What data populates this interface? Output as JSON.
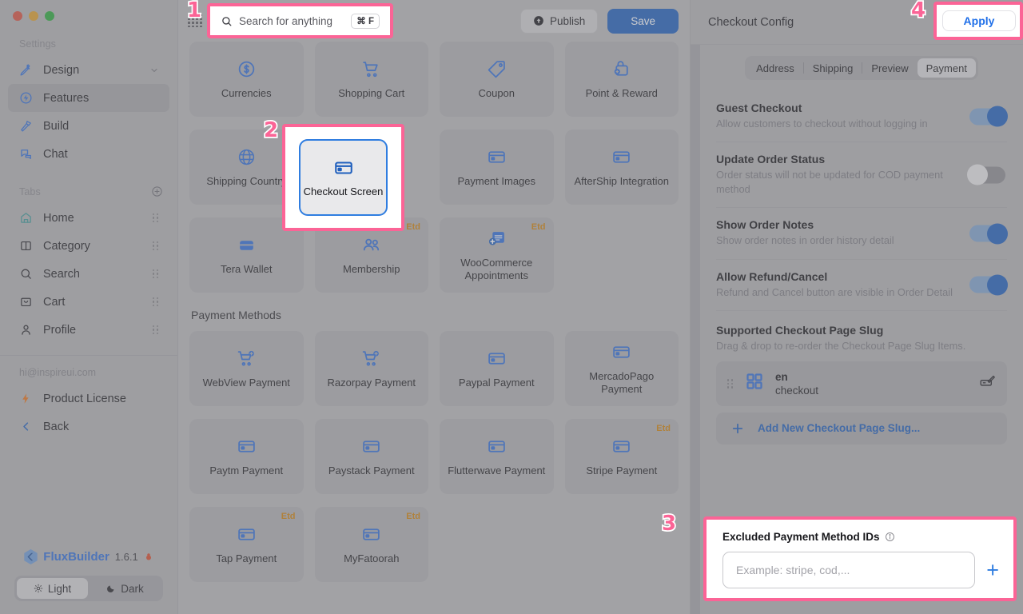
{
  "sidebar": {
    "settings_label": "Settings",
    "settings_items": [
      {
        "label": "Design",
        "icon": "design-icon",
        "chevron": true
      },
      {
        "label": "Features",
        "icon": "features-icon",
        "active": true
      },
      {
        "label": "Build",
        "icon": "build-icon"
      },
      {
        "label": "Chat",
        "icon": "chat-icon"
      }
    ],
    "tabs_label": "Tabs",
    "tabs_add_icon": "add-circle-icon",
    "tabs": [
      {
        "label": "Home",
        "icon": "home-icon"
      },
      {
        "label": "Category",
        "icon": "category-icon"
      },
      {
        "label": "Search",
        "icon": "search-icon"
      },
      {
        "label": "Cart",
        "icon": "cart-icon"
      },
      {
        "label": "Profile",
        "icon": "profile-icon"
      }
    ],
    "email": "hi@inspireui.com",
    "product_license": "Product License",
    "back": "Back",
    "brand_name": "FluxBuilder",
    "brand_version": "1.6.1",
    "theme": {
      "light": "Light",
      "dark": "Dark",
      "selected": "Light"
    }
  },
  "topbar": {
    "grid_icon": "app-grid-icon",
    "search_placeholder": "Search for anything",
    "search_shortcut": "⌘ F",
    "publish_label": "Publish",
    "save_label": "Save"
  },
  "features": {
    "tiles_row1": [
      {
        "name": "Currencies",
        "icon": "currency-dollar-icon"
      },
      {
        "name": "Shopping Cart",
        "icon": "shopping-cart-icon"
      },
      {
        "name": "Coupon",
        "icon": "coupon-tag-icon"
      },
      {
        "name": "Point & Reward",
        "icon": "point-reward-icon"
      }
    ],
    "tiles_row2": [
      {
        "name": "Shipping Country",
        "icon": "globe-icon"
      },
      {
        "name": "Checkout Screen",
        "icon": "credit-card-icon",
        "selected": true
      },
      {
        "name": "Payment Images",
        "icon": "credit-card-icon"
      },
      {
        "name": "AfterShip Integration",
        "icon": "credit-card-icon"
      }
    ],
    "tiles_row3": [
      {
        "name": "Tera Wallet",
        "icon": "wallet-icon"
      },
      {
        "name": "Membership",
        "icon": "members-icon",
        "badge": "Etd"
      },
      {
        "name": "WooCommerce Appointments",
        "icon": "appointments-icon",
        "badge": "Etd"
      }
    ],
    "payment_group_title": "Payment Methods",
    "payment_row1": [
      {
        "name": "WebView Payment",
        "icon": "cart-plus-icon"
      },
      {
        "name": "Razorpay Payment",
        "icon": "cart-plus-icon"
      },
      {
        "name": "Paypal Payment",
        "icon": "credit-card-icon"
      },
      {
        "name": "MercadoPago Payment",
        "icon": "credit-card-icon"
      }
    ],
    "payment_row2": [
      {
        "name": "Paytm Payment",
        "icon": "credit-card-icon"
      },
      {
        "name": "Paystack Payment",
        "icon": "credit-card-icon"
      },
      {
        "name": "Flutterwave Payment",
        "icon": "credit-card-icon"
      },
      {
        "name": "Stripe Payment",
        "icon": "credit-card-icon",
        "badge": "Etd"
      }
    ],
    "payment_row3": [
      {
        "name": "Tap Payment",
        "icon": "credit-card-icon",
        "badge": "Etd"
      },
      {
        "name": "MyFatoorah",
        "icon": "credit-card-icon",
        "badge": "Etd"
      }
    ]
  },
  "panel": {
    "title": "Checkout Config",
    "apply_label": "Apply",
    "tabs": [
      {
        "label": "Address"
      },
      {
        "label": "Shipping"
      },
      {
        "label": "Preview"
      },
      {
        "label": "Payment",
        "selected": true
      }
    ],
    "settings": [
      {
        "title": "Guest Checkout",
        "desc": "Allow customers to checkout without logging in",
        "toggle": "on"
      },
      {
        "title": "Update Order Status",
        "desc": "Order status will not be updated for COD payment method",
        "toggle": "off"
      },
      {
        "title": "Show Order Notes",
        "desc": "Show order notes in order history detail",
        "toggle": "on"
      },
      {
        "title": "Allow Refund/Cancel",
        "desc": "Refund and Cancel button are visible in Order Detail",
        "toggle": "on"
      }
    ],
    "slug": {
      "title": "Supported Checkout Page Slug",
      "desc": "Drag & drop to re-order the Checkout Page Slug Items.",
      "item": {
        "lang": "en",
        "path": "checkout",
        "edit_icon": "edit-pen-icon",
        "drag_icon": "drag-handle-icon",
        "grid_icon": "grid-squares-icon"
      },
      "add_label": "Add New Checkout Page Slug..."
    },
    "excluded": {
      "label": "Excluded Payment Method IDs",
      "info_icon": "info-circle-icon",
      "placeholder": "Example: stripe, cod,...",
      "value": "",
      "add_icon": "plus-icon"
    }
  },
  "callouts": {
    "one": "1",
    "two": "2",
    "three": "3",
    "four": "4",
    "accent": "#fb6496"
  }
}
